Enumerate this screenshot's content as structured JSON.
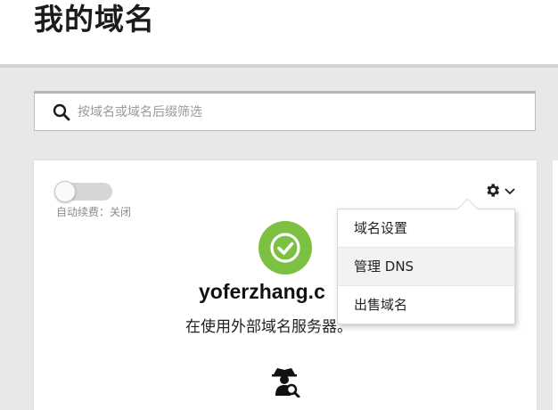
{
  "header": {
    "title": "我的域名"
  },
  "search": {
    "placeholder": "按域名或域名后缀筛选",
    "value": ""
  },
  "card": {
    "auto_renew_label": "自动续费：关闭",
    "auto_renew_enabled": false,
    "domain": "yoferzhang.c",
    "ns_status": "在使用外部域名服务器。",
    "status_color": "#7cc142"
  },
  "menu": {
    "items": [
      {
        "label": "域名设置"
      },
      {
        "label": "管理 DNS"
      },
      {
        "label": "出售域名"
      }
    ]
  },
  "icons": [
    "search-icon",
    "gear-icon",
    "chevron-down-icon",
    "check-circle-icon",
    "spy-search-icon"
  ]
}
